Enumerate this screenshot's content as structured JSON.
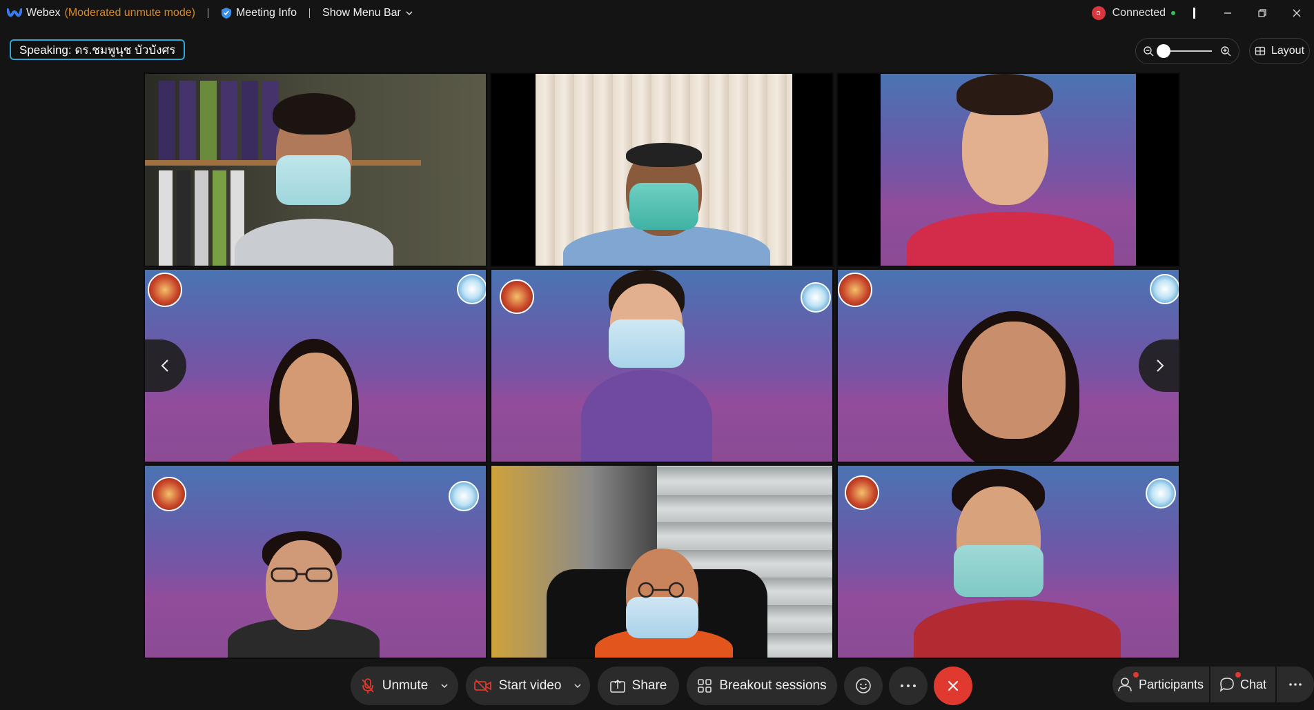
{
  "titlebar": {
    "app_name": "Webex",
    "mode": "(Moderated unmute mode)",
    "meeting_info": "Meeting Info",
    "show_menu_bar": "Show Menu Bar",
    "recording_badge": "o",
    "connection_status": "Connected"
  },
  "speaking": {
    "label": "Speaking: ดร.ชมพูนุช บัวบังศร"
  },
  "layout": {
    "label": "Layout"
  },
  "toolbar": {
    "unmute": "Unmute",
    "start_video": "Start video",
    "share": "Share",
    "breakout": "Breakout sessions",
    "participants": "Participants",
    "chat": "Chat"
  },
  "colors": {
    "accent": "#2fa8d8",
    "end_call": "#e0392f",
    "mode_text": "#d68a2c",
    "connected_dot": "#35c15a"
  },
  "icons": [
    "webex-logo-icon",
    "shield-icon",
    "chevron-down-icon",
    "minimize-icon",
    "restore-icon",
    "close-icon",
    "zoom-out-icon",
    "zoom-in-icon",
    "layout-icon",
    "microphone-muted-icon",
    "camera-off-icon",
    "share-icon",
    "breakout-icon",
    "reactions-icon",
    "more-icon",
    "end-call-icon",
    "participants-icon",
    "chat-icon",
    "chevron-left-icon",
    "chevron-right-icon"
  ]
}
